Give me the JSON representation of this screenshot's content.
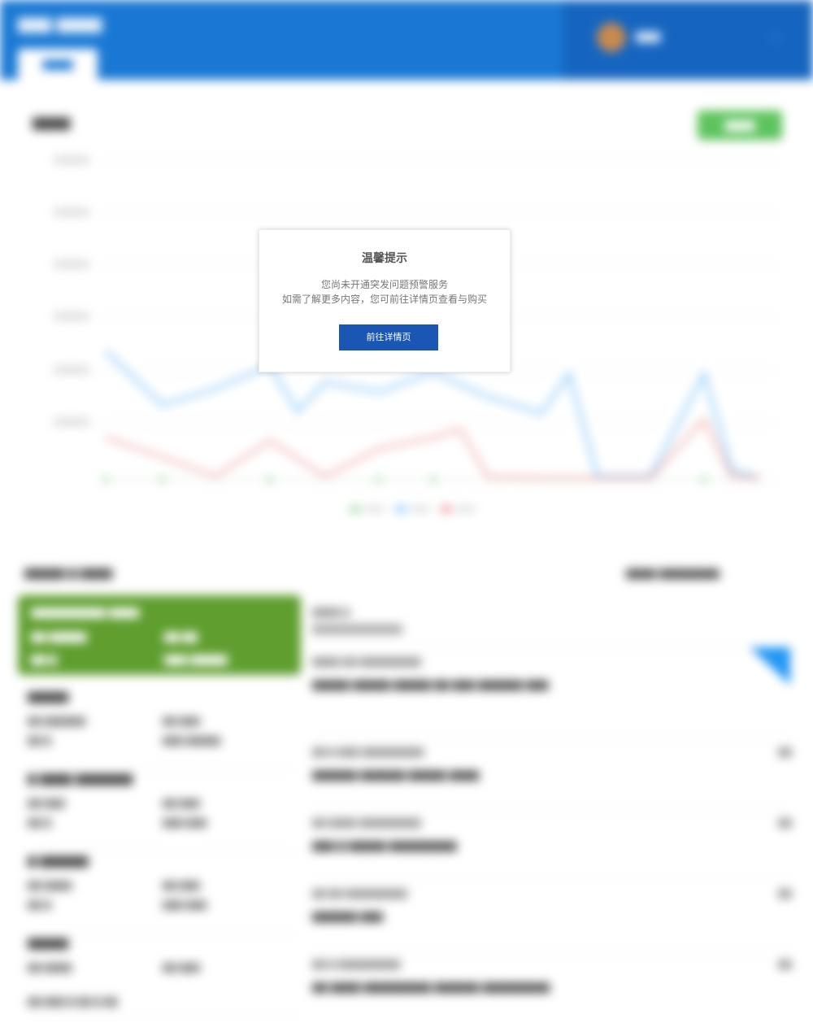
{
  "modal": {
    "title": "温馨提示",
    "line1": "您尚未开通突发问题预警服务",
    "line2": "如需了解更多内容，您可前往详情页查看与购买",
    "button_label": "前往详情页"
  },
  "colors": {
    "header_blue": "#1a78d4",
    "header_dark_blue": "#1565c0",
    "modal_button": "#1a56b4",
    "green_accent": "#5dc35d",
    "card_green": "#5f9e2f",
    "series_blue": "#90caf9",
    "series_red": "#ef9a9a",
    "series_green": "#a5d6a7"
  }
}
